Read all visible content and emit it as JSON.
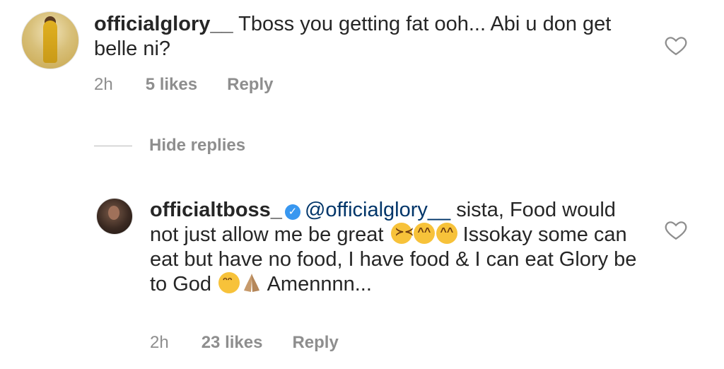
{
  "comments": [
    {
      "username": "officialglory__",
      "text": "Tboss you getting fat ooh... Abi u don get belle ni?",
      "time": "2h",
      "likes": "5 likes",
      "reply": "Reply"
    }
  ],
  "replies_toggle": {
    "label": "Hide replies"
  },
  "reply": {
    "username": "officialtboss_",
    "verified": true,
    "mention": "@officialglory__",
    "text_part1": " sista, Food would not just allow me be great ",
    "text_part2": " Issokay some can eat but have no food, I have food & I can eat Glory be to God ",
    "text_part3": " Amennnn...",
    "emojis": [
      "tongue-out-emoji",
      "laughing-emoji",
      "laughing-emoji",
      "smiling-emoji",
      "praying-hands-emoji"
    ],
    "time": "2h",
    "likes": "23 likes",
    "reply": "Reply"
  },
  "colors": {
    "text": "#262626",
    "meta": "#8e8e8e",
    "mention": "#003569",
    "verified": "#3897f0"
  }
}
